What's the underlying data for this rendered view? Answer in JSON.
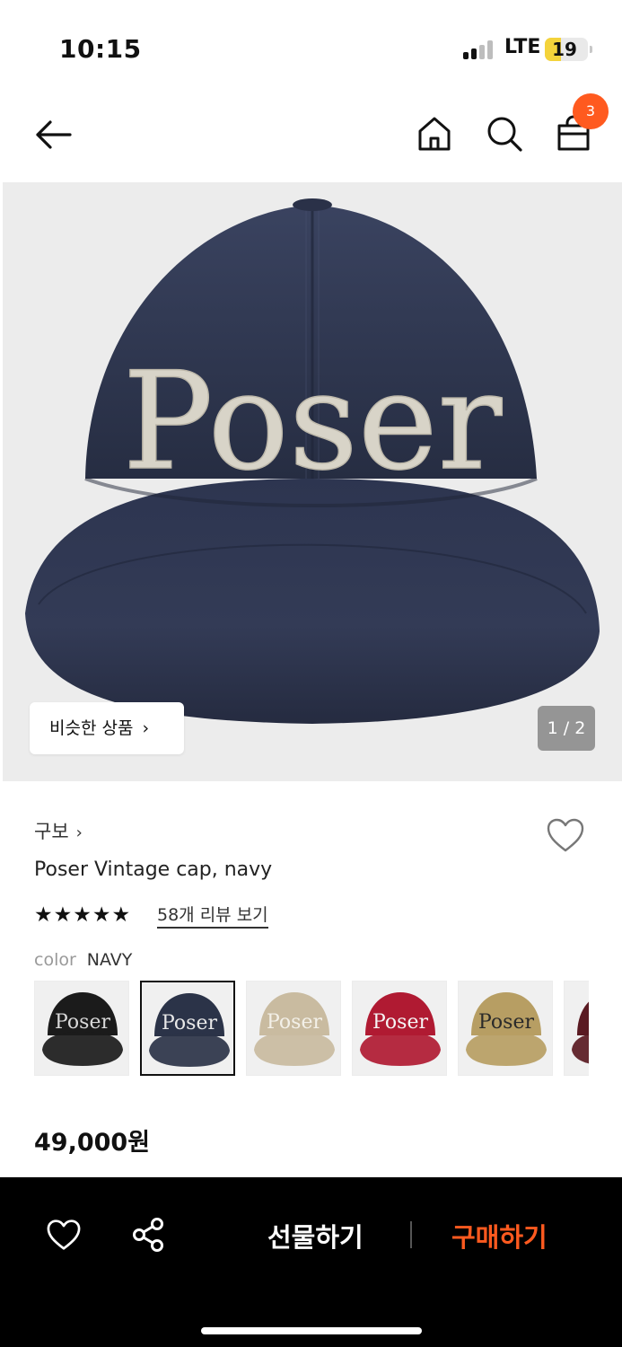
{
  "status_bar": {
    "time": "10:15",
    "network": "LTE",
    "battery": "19"
  },
  "nav": {
    "back_icon": "arrow-left-icon",
    "home_icon": "home-icon",
    "search_icon": "search-icon",
    "cart_icon": "shopping-bag-icon",
    "cart_count": "3"
  },
  "hero": {
    "cap_text": "Poser",
    "similar_label": "비슷한 상품",
    "similar_chevron": "›",
    "pager": "1 / 2"
  },
  "product": {
    "brand": "구보",
    "brand_chevron": "›",
    "name": "Poser Vintage cap, navy",
    "stars": "★★★★★",
    "rating": 5,
    "review_link": "58개 리뷰 보기",
    "color_label": "color",
    "color_value": "NAVY",
    "swatches": [
      {
        "cap_color": "#1b1b1b",
        "text": "Poser",
        "text_color": "#d9d9d9"
      },
      {
        "cap_color": "#2b3348",
        "text": "Poser",
        "text_color": "#e8e8e8",
        "selected": true
      },
      {
        "cap_color": "#c9bba0",
        "text": "Poser",
        "text_color": "#f3f0e8"
      },
      {
        "cap_color": "#b01a32",
        "text": "Poser",
        "text_color": "#f5f5f5"
      },
      {
        "cap_color": "#b79e63",
        "text": "Poser",
        "text_color": "#2a2a2a"
      },
      {
        "cap_color": "#5a1a22",
        "text": "P",
        "text_color": "#e0e0e0"
      }
    ],
    "price": "49,000원"
  },
  "bottom_bar": {
    "like_icon": "heart-icon",
    "share_icon": "share-icon",
    "gift_label": "선물하기",
    "buy_label": "구매하기",
    "buy_color": "#ff5a1f"
  }
}
